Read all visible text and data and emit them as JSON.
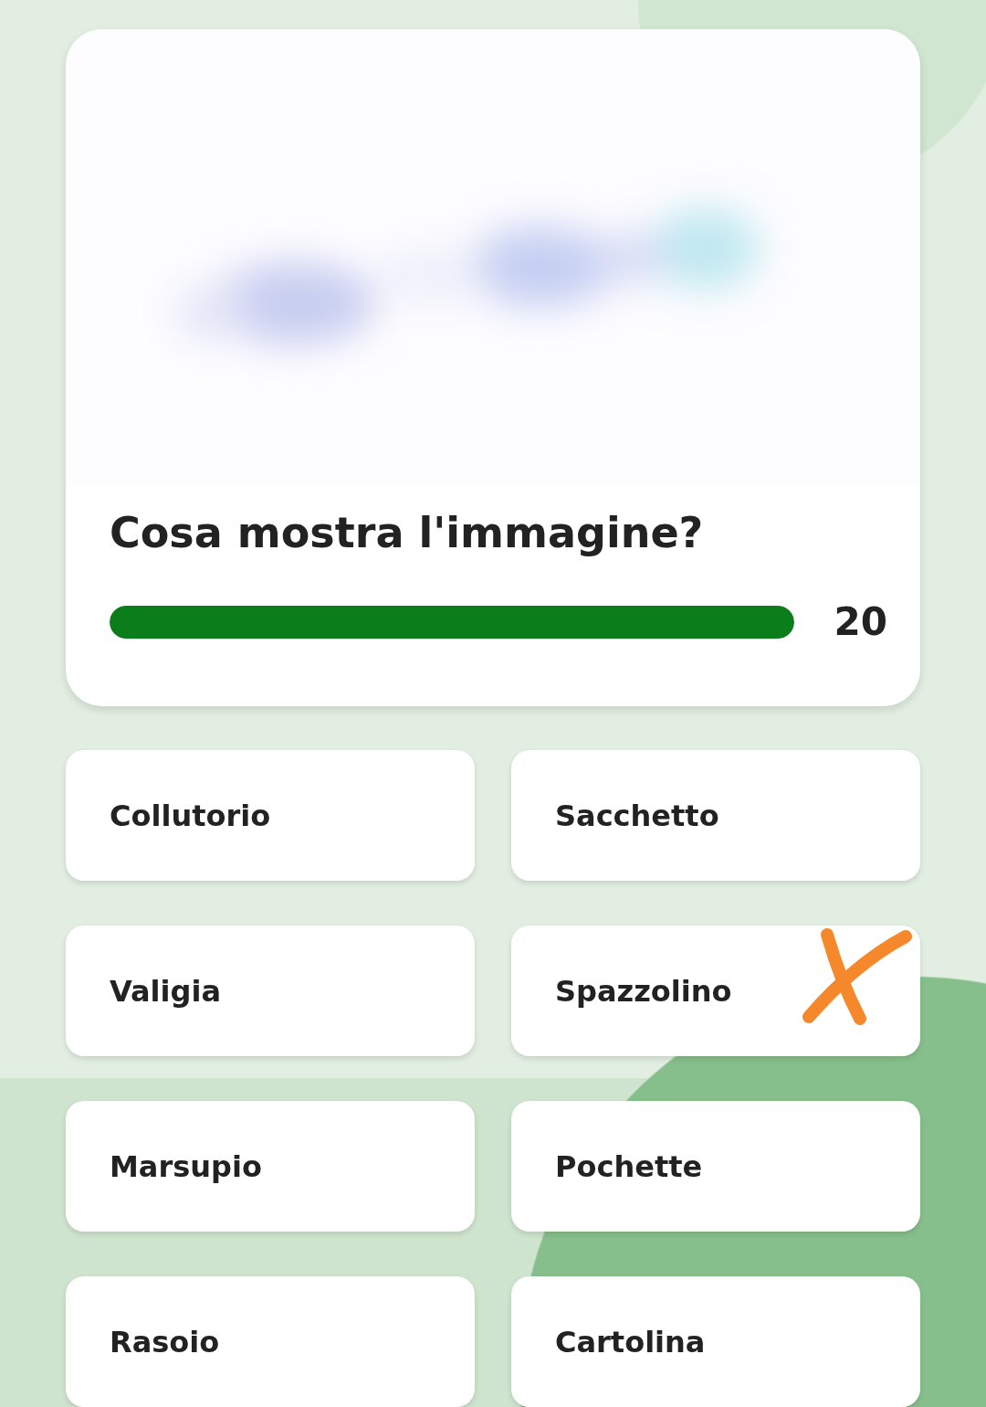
{
  "question": {
    "kind": "picture",
    "text": "Cosa mostra l'immagine?"
  },
  "timer": {
    "level": 1.0,
    "reading": "20"
  },
  "answers": [
    {
      "label": "Collutorio",
      "marked": false
    },
    {
      "label": "Sacchetto",
      "marked": false
    },
    {
      "label": "Valigia",
      "marked": false
    },
    {
      "label": "Spazzolino",
      "marked": true
    },
    {
      "label": "Marsupio",
      "marked": false
    },
    {
      "label": "Pochette",
      "marked": false
    },
    {
      "label": "Rasoio",
      "marked": false
    },
    {
      "label": "Cartolina",
      "marked": false
    }
  ]
}
